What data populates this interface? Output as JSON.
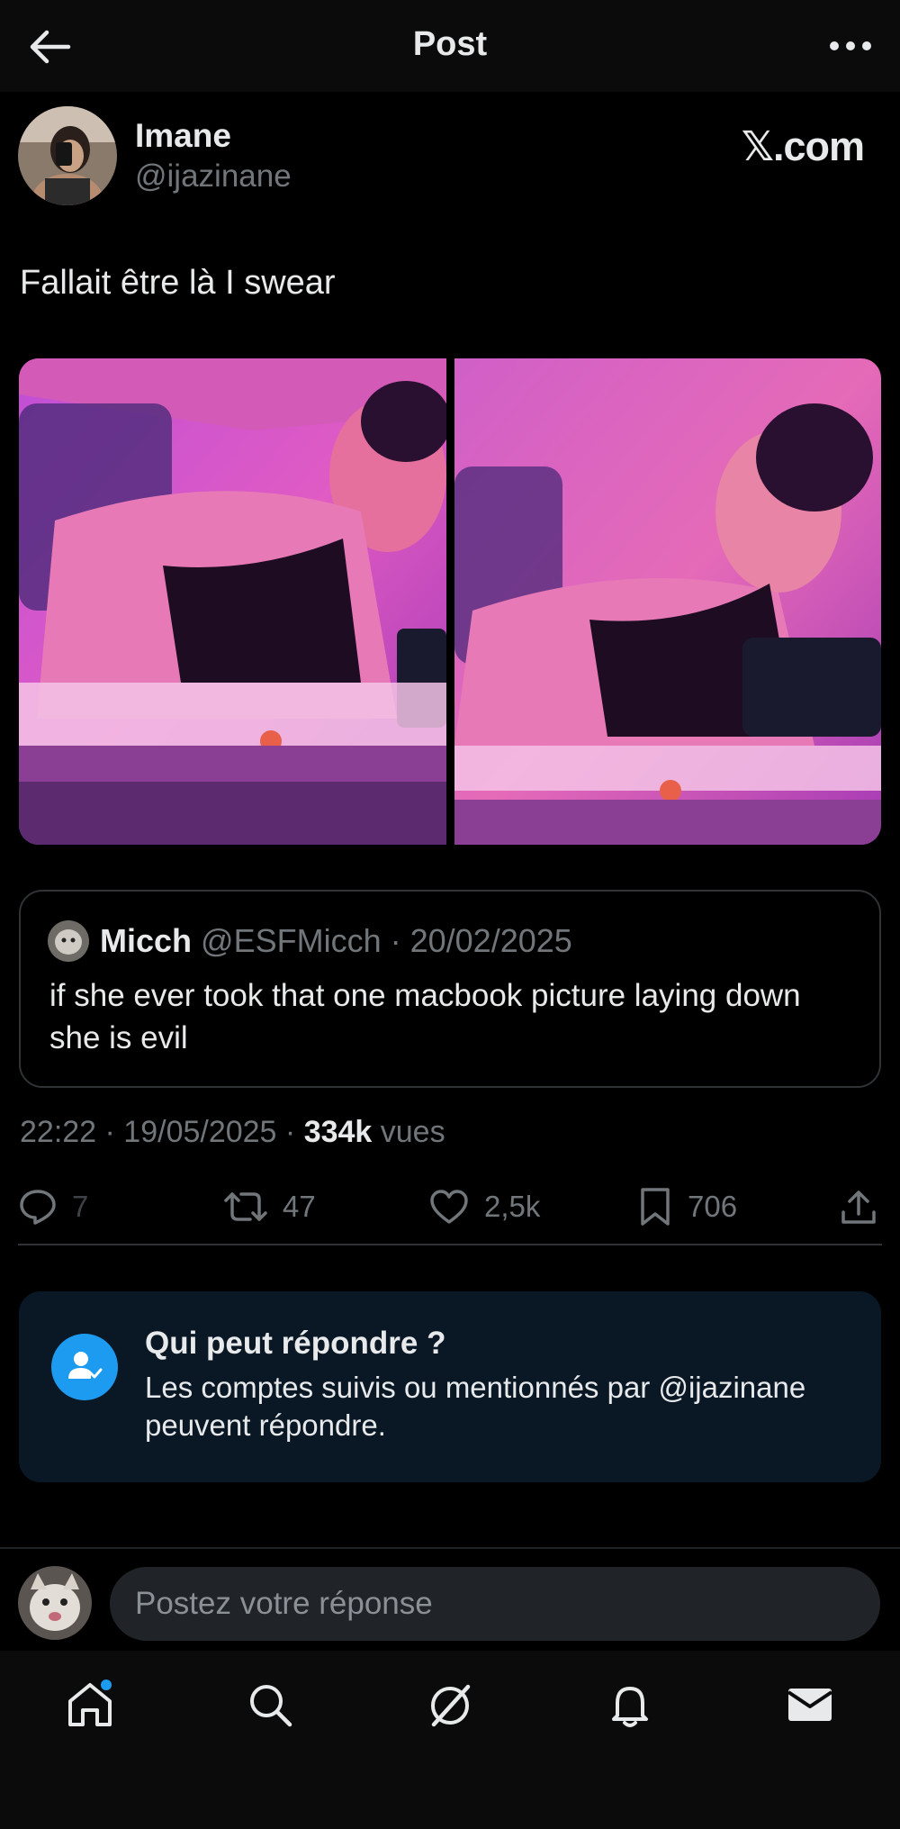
{
  "header": {
    "title": "Post"
  },
  "author": {
    "name": "Imane",
    "handle": "@ijazinane",
    "watermark": "𝕏.com"
  },
  "tweet": {
    "text": "Fallait être là I swear"
  },
  "quote": {
    "name": "Micch",
    "meta": "@ESFMicch · 20/02/2025",
    "text": "if she ever took that one macbook picture laying down she is evil"
  },
  "meta": {
    "time_date": "22:22 · 19/05/2025 · ",
    "views_count": "334k",
    "views_label": " vues"
  },
  "actions": {
    "replies": "7",
    "reposts": "47",
    "likes": "2,5k",
    "bookmarks": "706"
  },
  "who_can_reply": {
    "title": "Qui peut répondre ?",
    "description": "Les comptes suivis ou mentionnés par @ijazinane peuvent répondre."
  },
  "reply": {
    "placeholder": "Postez votre réponse"
  },
  "colors": {
    "accent": "#1d9bf0",
    "muted": "#71767b",
    "background": "#000000",
    "text": "#e7e9ea"
  },
  "nav": {
    "items": [
      "home-icon",
      "search-icon",
      "grok-icon",
      "bell-icon",
      "mail-icon"
    ],
    "home_has_notification": true
  }
}
